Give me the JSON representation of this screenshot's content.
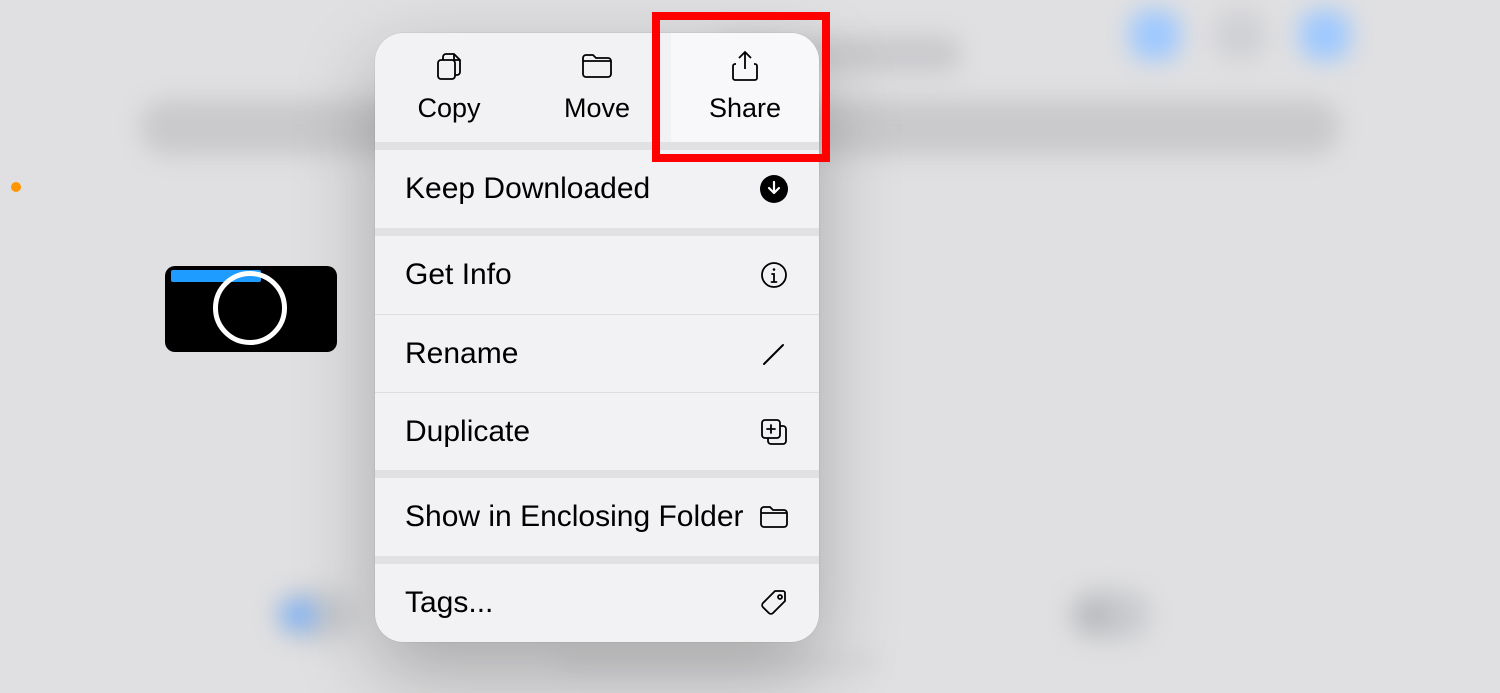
{
  "action_row": {
    "copy": "Copy",
    "move": "Move",
    "share": "Share"
  },
  "menu": {
    "keep_downloaded": "Keep Downloaded",
    "get_info": "Get Info",
    "rename": "Rename",
    "duplicate": "Duplicate",
    "show_in_enclosing": "Show in Enclosing Folder",
    "tags": "Tags..."
  },
  "highlight": "share-button"
}
